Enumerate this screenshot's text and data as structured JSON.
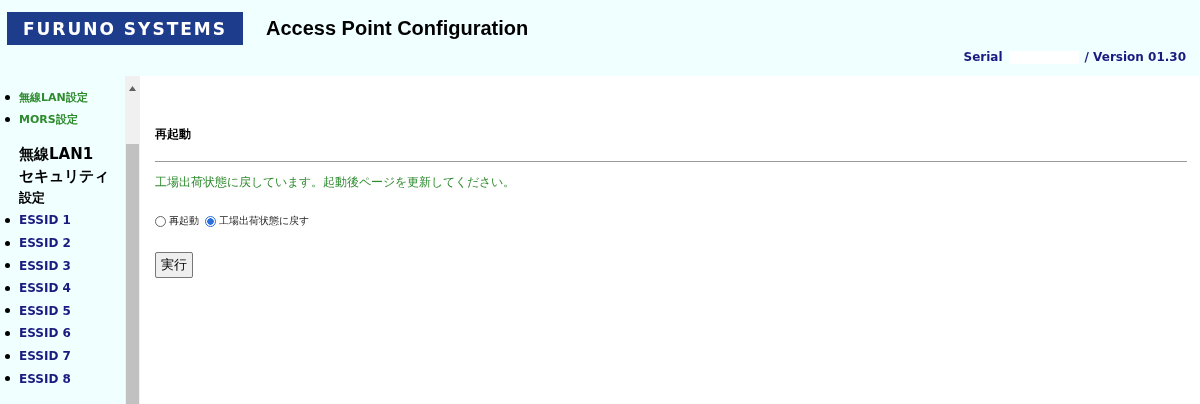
{
  "header": {
    "logo": "FURUNO SYSTEMS",
    "title": "Access Point Configuration",
    "serial_label": "Serial",
    "version": "/ Version 01.30"
  },
  "sidebar": {
    "menu_links": [
      "無線LAN設定",
      "MORS設定"
    ],
    "section_heading": [
      "無線LAN1",
      "セキュリティ",
      "設定"
    ],
    "essid_links": [
      "ESSID 1",
      "ESSID 2",
      "ESSID 3",
      "ESSID 4",
      "ESSID 5",
      "ESSID 6",
      "ESSID 7",
      "ESSID 8"
    ]
  },
  "main": {
    "heading": "再起動",
    "message": "工場出荷状態に戻しています。起動後ページを更新してください。",
    "options": [
      {
        "label": "再起動",
        "selected": false
      },
      {
        "label": "工場出荷状態に戻す",
        "selected": true
      }
    ],
    "button": "実行"
  }
}
